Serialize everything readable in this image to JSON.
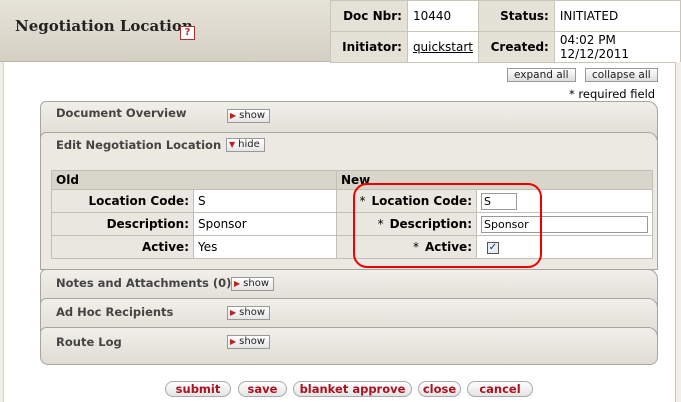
{
  "header": {
    "title": "Negotiation Location",
    "help_icon": "help-icon",
    "doc_nbr_label": "Doc Nbr:",
    "doc_nbr": "10440",
    "status_label": "Status:",
    "status": "INITIATED",
    "initiator_label": "Initiator:",
    "initiator": "quickstart",
    "created_label": "Created:",
    "created": "04:02 PM 12/12/2011"
  },
  "controls": {
    "expand_all": "expand all",
    "collapse_all": "collapse all",
    "required_field": "* required field"
  },
  "tabs": {
    "document_overview": {
      "label": "Document Overview",
      "button": "show"
    },
    "edit": {
      "label": "Edit Negotiation Location",
      "button": "hide"
    },
    "notes": {
      "label": "Notes and Attachments (0)",
      "button": "show"
    },
    "adhoc": {
      "label": "Ad Hoc Recipients",
      "button": "show"
    },
    "route_log": {
      "label": "Route Log",
      "button": "show"
    }
  },
  "edit_table": {
    "old_header": "Old",
    "new_header": "New",
    "required_star": "*",
    "rows": [
      {
        "label": "Location Code:",
        "old": "S",
        "new": "S"
      },
      {
        "label": "Description:",
        "old": "Sponsor",
        "new": "Sponsor"
      },
      {
        "label": "Active:",
        "old": "Yes",
        "new_checked": true
      }
    ],
    "checkmark": "✓"
  },
  "actions": {
    "submit": "submit",
    "save": "save",
    "blanket_approve": "blanket approve",
    "close": "close",
    "cancel": "cancel"
  }
}
